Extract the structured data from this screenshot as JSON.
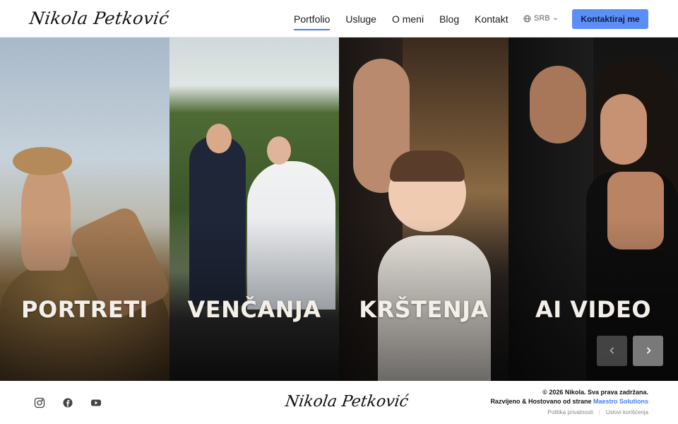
{
  "header": {
    "logo": "Nikola Petković",
    "nav": [
      {
        "label": "Portfolio",
        "active": true
      },
      {
        "label": "Usluge",
        "active": false
      },
      {
        "label": "O meni",
        "active": false
      },
      {
        "label": "Blog",
        "active": false
      },
      {
        "label": "Kontakt",
        "active": false
      }
    ],
    "language": "SRB",
    "cta_label": "Kontaktiraj me"
  },
  "panels": [
    {
      "label": "PORTRETI"
    },
    {
      "label": "VENČANJA"
    },
    {
      "label": "KRŠTENJA"
    },
    {
      "label": "AI VIDEO"
    }
  ],
  "slider": {
    "prev_icon": "chevron-left-icon",
    "next_icon": "chevron-right-icon"
  },
  "footer": {
    "social_icons": [
      "instagram-icon",
      "facebook-icon",
      "youtube-icon"
    ],
    "logo": "Nikola Petković",
    "copyright": "© 2026 Nikola. Sva prava zadržana.",
    "credit_prefix": "Razvijeno & Hostovano od strane",
    "credit_link": "Maestro Solutions",
    "legal": [
      "Politika privatnosti",
      "Uslovi korišćenja"
    ]
  },
  "colors": {
    "accent": "#5b8ef7",
    "active_underline": "#3f7ff5",
    "panel_label": "#f4efe8"
  }
}
